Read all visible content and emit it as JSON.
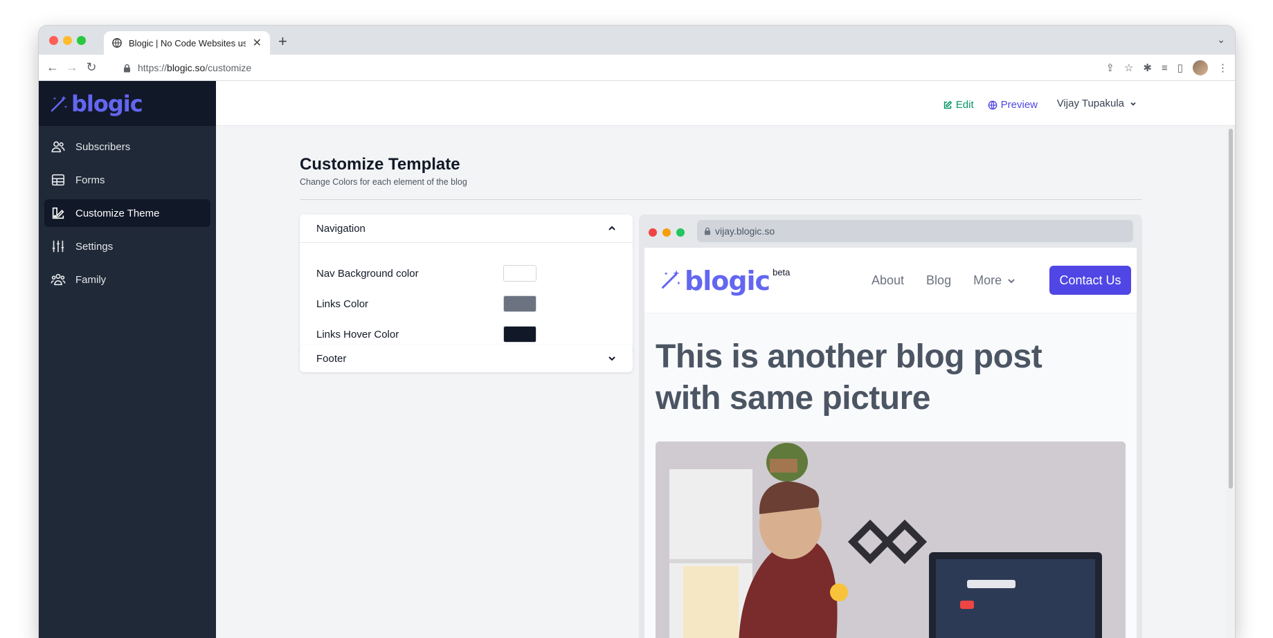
{
  "browser": {
    "tab_title": "Blogic | No Code Websites using",
    "url_scheme": "https://",
    "url_host": "blogic.so",
    "url_path": "/customize"
  },
  "sidebar": {
    "logo": "blogic",
    "items": [
      {
        "label": "Subscribers",
        "icon": "users-icon"
      },
      {
        "label": "Forms",
        "icon": "table-icon"
      },
      {
        "label": "Customize Theme",
        "icon": "brush-icon"
      },
      {
        "label": "Settings",
        "icon": "sliders-icon"
      },
      {
        "label": "Family",
        "icon": "user-group-icon"
      }
    ]
  },
  "topbar": {
    "edit_label": "Edit",
    "preview_label": "Preview",
    "user_name": "Vijay Tupakula"
  },
  "page": {
    "title": "Customize Template",
    "subtitle": "Change Colors for each element of the blog"
  },
  "navigation_panel": {
    "title": "Navigation",
    "rows": [
      {
        "label": "Nav Background color",
        "color": "#ffffff"
      },
      {
        "label": "Links Color",
        "color": "#6b7280"
      },
      {
        "label": "Links Hover Color",
        "color": "#111827"
      }
    ]
  },
  "footer_panel": {
    "title": "Footer"
  },
  "preview": {
    "url": "vijay.blogic.so",
    "logo": "blogic",
    "logo_badge": "beta",
    "links": [
      "About",
      "Blog",
      "More"
    ],
    "contact_label": "Contact Us",
    "post_title": "This is another blog post with same picture"
  },
  "colors": {
    "accent": "#4f46e5",
    "brand": "#6366f1",
    "sidebar_bg": "#1f2937",
    "edit_green": "#059669"
  }
}
